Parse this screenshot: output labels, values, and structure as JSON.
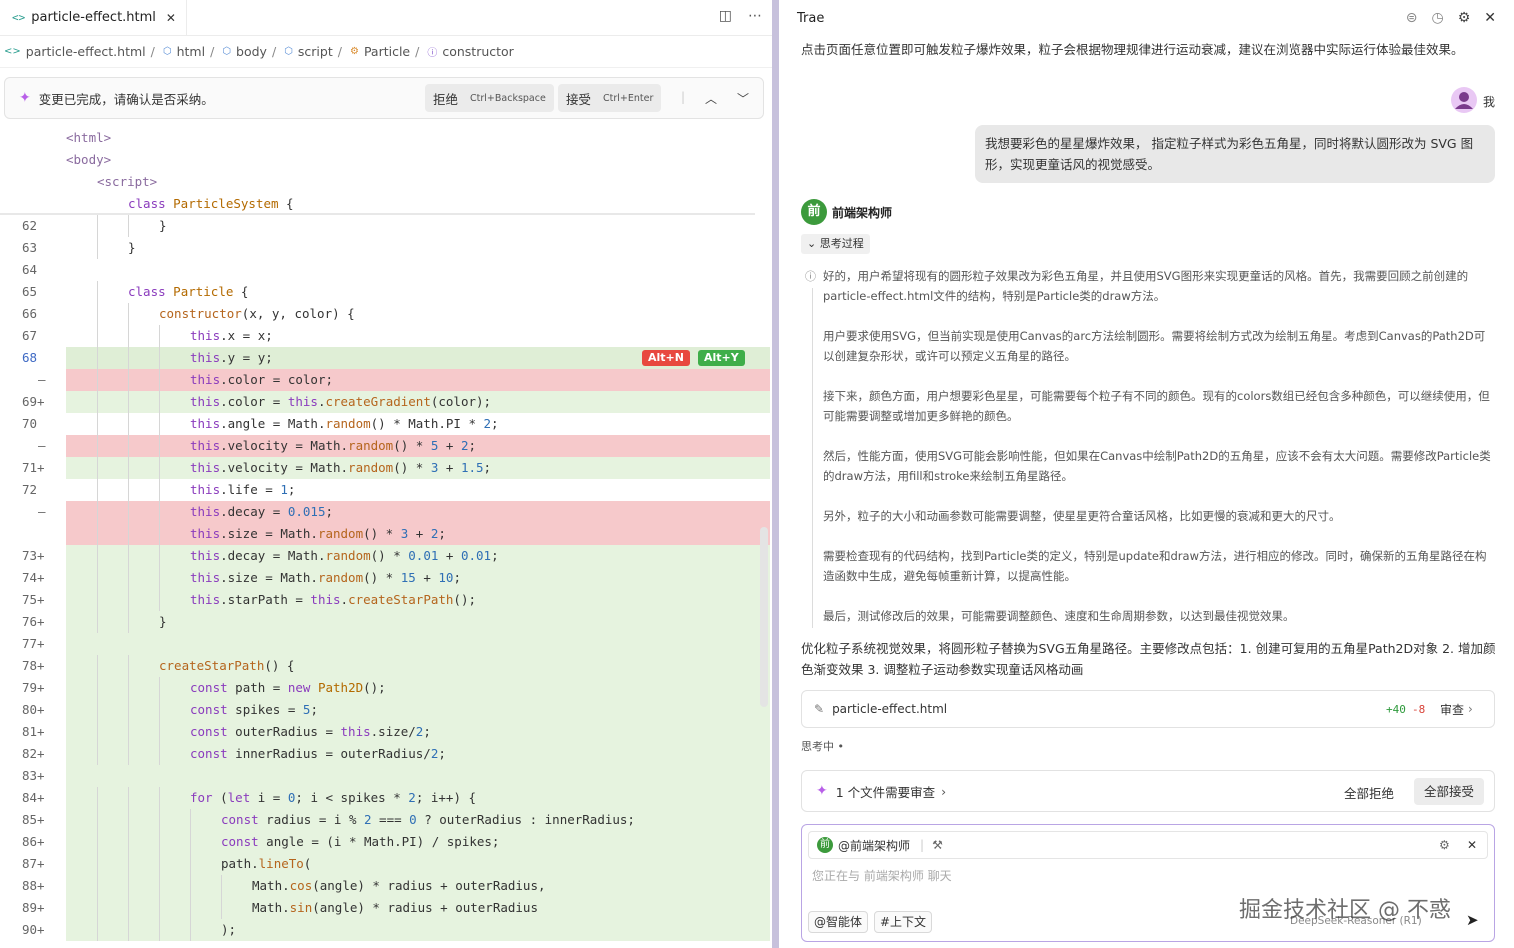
{
  "editor": {
    "tab_name": "particle-effect.html",
    "breadcrumb": [
      "particle-effect.html",
      "html",
      "body",
      "script",
      "Particle",
      "constructor"
    ],
    "review_bar": {
      "message": "变更已完成，请确认是否采纳。",
      "reject_label": "拒绝",
      "reject_shortcut": "Ctrl+Backspace",
      "accept_label": "接受",
      "accept_shortcut": "Ctrl+Enter"
    },
    "sticky_lines": [
      "<html>",
      "<body>",
      "<script>",
      "class ParticleSystem {"
    ],
    "lines": [
      {
        "num": "62",
        "mark": "",
        "type": "ctx",
        "text": "}"
      },
      {
        "num": "63",
        "mark": "",
        "type": "ctx",
        "text": "}"
      },
      {
        "num": "64",
        "mark": "",
        "type": "ctx",
        "text": ""
      },
      {
        "num": "65",
        "mark": "",
        "type": "ctx",
        "text": "class Particle {"
      },
      {
        "num": "66",
        "mark": "",
        "type": "ctx",
        "text": "constructor(x, y, color) {"
      },
      {
        "num": "67",
        "mark": "",
        "type": "ctx",
        "text": "this.x = x;"
      },
      {
        "num": "68",
        "mark": "",
        "type": "hl",
        "text": "this.y = y;"
      },
      {
        "num": "—",
        "mark": "",
        "type": "del",
        "text": "this.color = color;"
      },
      {
        "num": "69",
        "mark": "+",
        "type": "add",
        "text": "this.color = this.createGradient(color);"
      },
      {
        "num": "70",
        "mark": "",
        "type": "ctx",
        "text": "this.angle = Math.random() * Math.PI * 2;"
      },
      {
        "num": "—",
        "mark": "",
        "type": "del",
        "text": "this.velocity = Math.random() * 5 + 2;"
      },
      {
        "num": "71",
        "mark": "+",
        "type": "add",
        "text": "this.velocity = Math.random() * 3 + 1.5;"
      },
      {
        "num": "72",
        "mark": "",
        "type": "ctx",
        "text": "this.life = 1;"
      },
      {
        "num": "—",
        "mark": "",
        "type": "del",
        "text": "this.decay = 0.015;"
      },
      {
        "num": "",
        "mark": "",
        "type": "del",
        "text": "this.size = Math.random() * 3 + 2;"
      },
      {
        "num": "73",
        "mark": "+",
        "type": "add",
        "text": "this.decay = Math.random() * 0.01 + 0.01;"
      },
      {
        "num": "74",
        "mark": "+",
        "type": "add",
        "text": "this.size = Math.random() * 15 + 10;"
      },
      {
        "num": "75",
        "mark": "+",
        "type": "add",
        "text": "this.starPath = this.createStarPath();"
      },
      {
        "num": "76",
        "mark": "+",
        "type": "add",
        "text": "}"
      },
      {
        "num": "77",
        "mark": "+",
        "type": "add",
        "text": ""
      },
      {
        "num": "78",
        "mark": "+",
        "type": "add",
        "text": "createStarPath() {"
      },
      {
        "num": "79",
        "mark": "+",
        "type": "add",
        "text": "const path = new Path2D();"
      },
      {
        "num": "80",
        "mark": "+",
        "type": "add",
        "text": "const spikes = 5;"
      },
      {
        "num": "81",
        "mark": "+",
        "type": "add",
        "text": "const outerRadius = this.size/2;"
      },
      {
        "num": "82",
        "mark": "+",
        "type": "add",
        "text": "const innerRadius = outerRadius/2;"
      },
      {
        "num": "83",
        "mark": "+",
        "type": "add",
        "text": ""
      },
      {
        "num": "84",
        "mark": "+",
        "type": "add",
        "text": "for (let i = 0; i < spikes * 2; i++) {"
      },
      {
        "num": "85",
        "mark": "+",
        "type": "add",
        "text": "const radius = i % 2 === 0 ? outerRadius : innerRadius;"
      },
      {
        "num": "86",
        "mark": "+",
        "type": "add",
        "text": "const angle = (i * Math.PI) / spikes;"
      },
      {
        "num": "87",
        "mark": "+",
        "type": "add",
        "text": "path.lineTo("
      },
      {
        "num": "88",
        "mark": "+",
        "type": "add",
        "text": "Math.cos(angle) * radius + outerRadius,"
      },
      {
        "num": "89",
        "mark": "+",
        "type": "add",
        "text": "Math.sin(angle) * radius + outerRadius"
      },
      {
        "num": "90",
        "mark": "+",
        "type": "add",
        "text": ");"
      }
    ],
    "inline_buttons": {
      "reject": "Alt+N",
      "accept": "Alt+Y"
    }
  },
  "chat": {
    "title": "Trae",
    "intro": "点击页面任意位置即可触发粒子爆炸效果，粒子会根据物理规律进行运动衰减，建议在浏览器中实际运行体验最佳效果。",
    "user_label": "我",
    "user_message": "我想要彩色的星星爆炸效果， 指定粒子样式为彩色五角星，同时将默认圆形改为 SVG 图形，实现更童话风的视觉感受。",
    "agent_avatar_char": "前",
    "agent_name": "前端架构师",
    "thinking_label": "思考过程",
    "thinking_paragraphs": [
      "好的，用户希望将现有的圆形粒子效果改为彩色五角星，并且使用SVG图形来实现更童话的风格。首先，我需要回顾之前创建的particle-effect.html文件的结构，特别是Particle类的draw方法。",
      "用户要求使用SVG，但当前实现是使用Canvas的arc方法绘制圆形。需要将绘制方式改为绘制五角星。考虑到Canvas的Path2D可以创建复杂形状，或许可以预定义五角星的路径。",
      "接下来，颜色方面，用户想要彩色星星，可能需要每个粒子有不同的颜色。现有的colors数组已经包含多种颜色，可以继续使用，但可能需要调整或增加更多鲜艳的颜色。",
      "然后，性能方面，使用SVG可能会影响性能，但如果在Canvas中绘制Path2D的五角星，应该不会有太大问题。需要修改Particle类的draw方法，用fill和stroke来绘制五角星路径。",
      "另外，粒子的大小和动画参数可能需要调整，使星星更符合童话风格，比如更慢的衰减和更大的尺寸。",
      "需要检查现有的代码结构，找到Particle类的定义，特别是update和draw方法，进行相应的修改。同时，确保新的五角星路径在构造函数中生成，避免每帧重新计算，以提高性能。",
      "最后，测试修改后的效果，可能需要调整颜色、速度和生命周期参数，以达到最佳视觉效果。"
    ],
    "summary": "优化粒子系统视觉效果，将圆形粒子替换为SVG五角星路径。主要修改点包括：1. 创建可复用的五角星Path2D对象 2. 增加颜色渐变效果 3. 调整粒子运动参数实现童话风格动画",
    "file_card": {
      "name": "particle-effect.html",
      "added": "+40",
      "removed": "-8",
      "review_label": "审查"
    },
    "status": "思考中 •",
    "review_card": {
      "text": "1  个文件需要审查",
      "reject_all": "全部拒绝",
      "accept_all": "全部接受"
    },
    "input": {
      "agent_tag": "@前端架构师",
      "placeholder": "您正在与 前端架构师 聊天",
      "chip_agent": "@智能体",
      "chip_context": "#上下文",
      "model": "DeepSeek-Reasoner (R1)"
    },
    "watermark": "掘金技术社区 @ 不惑"
  },
  "colors": {
    "accent": "#b85fe8",
    "agent_green": "#3c9a3c",
    "divider": "#c7c1dc",
    "add_bg": "#e6f3df",
    "del_bg": "#f6c9cb",
    "alt_reject": "#e8483f",
    "alt_accept": "#3fae49"
  }
}
